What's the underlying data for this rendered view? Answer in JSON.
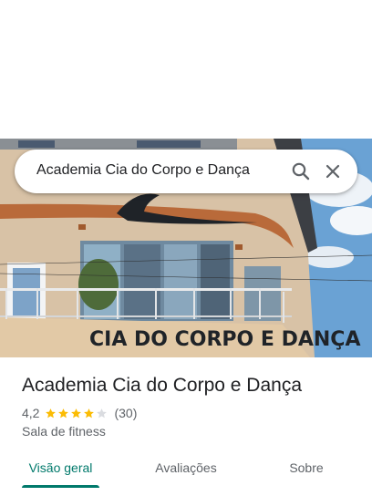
{
  "search": {
    "query": "Academia Cia do Corpo e Dança"
  },
  "photo": {
    "sign_text": "CIA DO CORPO E DANÇA"
  },
  "place": {
    "title": "Academia Cia do Corpo e Dança",
    "rating": "4,2",
    "stars": 4.2,
    "review_count": "(30)",
    "category": "Sala de fitness"
  },
  "tabs": [
    {
      "label": "Visão geral",
      "active": true
    },
    {
      "label": "Avaliações",
      "active": false
    },
    {
      "label": "Sobre",
      "active": false
    }
  ],
  "colors": {
    "accent": "#00796b",
    "star": "#fbbc04",
    "star_empty": "#dadce0"
  },
  "icons": {
    "search": "search-icon",
    "close": "close-icon"
  }
}
